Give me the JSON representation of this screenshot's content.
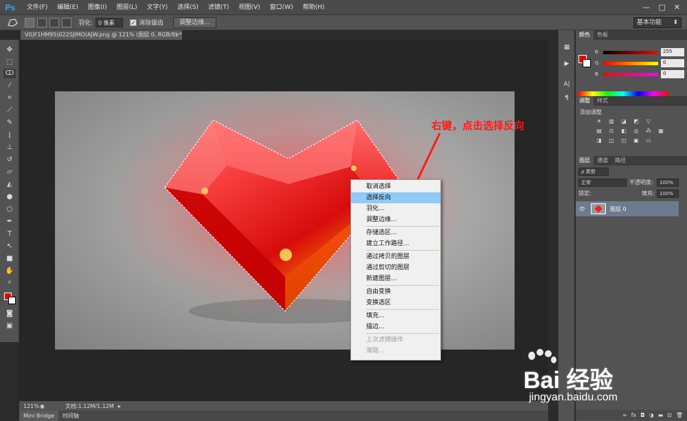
{
  "app": {
    "logo": "Ps",
    "menu": [
      "文件(F)",
      "编辑(E)",
      "图像(I)",
      "图层(L)",
      "文字(Y)",
      "选择(S)",
      "滤镜(T)",
      "视图(V)",
      "窗口(W)",
      "帮助(H)"
    ],
    "window_controls": [
      "—",
      "□",
      "✕"
    ]
  },
  "options": {
    "feather_label": "羽化:",
    "feather_value": "0 像素",
    "antialias_label": "消除锯齿",
    "refine_edge_button": "调整边缘...",
    "workspace": "基本功能"
  },
  "document": {
    "tab_title": "V0)F1HM95)022SJIMO(AJW.png @ 121% (图层 0, RGB/8) *",
    "tab_close": "×",
    "zoom": "121%",
    "doc_size": "文档:1.12M/1.12M"
  },
  "bottom_tabs": [
    "Mini Bridge",
    "时间轴"
  ],
  "color_panel": {
    "tabs": [
      "颜色",
      "色板"
    ],
    "sliders": [
      {
        "label": "R",
        "value": "255",
        "gradient": "linear-gradient(to right,#000,#f00)"
      },
      {
        "label": "G",
        "value": "0",
        "gradient": "linear-gradient(to right,#f00,#ff0)"
      },
      {
        "label": "B",
        "value": "0",
        "gradient": "linear-gradient(to right,#f00,#f0f)"
      }
    ],
    "foreground": "#e80000",
    "background": "#ffffff"
  },
  "adjustments": {
    "tabs": [
      "调整",
      "样式"
    ],
    "title": "添加调整"
  },
  "layers": {
    "tabs": [
      "图层",
      "通道",
      "路径"
    ],
    "filter": "ρ 类型",
    "blend_mode": "正常",
    "opacity_label": "不透明度:",
    "opacity": "100%",
    "lock_label": "锁定:",
    "fill_label": "填充:",
    "fill": "100%",
    "layer_name": "图层 0"
  },
  "context_menu": {
    "items": [
      {
        "label": "取消选择",
        "state": "normal"
      },
      {
        "label": "选择反向",
        "state": "highlighted"
      },
      {
        "label": "羽化...",
        "state": "normal"
      },
      {
        "label": "调整边缘...",
        "state": "normal"
      },
      {
        "sep": true
      },
      {
        "label": "存储选区...",
        "state": "normal"
      },
      {
        "label": "建立工作路径...",
        "state": "normal"
      },
      {
        "sep": true
      },
      {
        "label": "通过拷贝的图层",
        "state": "normal"
      },
      {
        "label": "通过剪切的图层",
        "state": "normal"
      },
      {
        "label": "新建图层...",
        "state": "normal"
      },
      {
        "sep": true
      },
      {
        "label": "自由变换",
        "state": "normal"
      },
      {
        "label": "变换选区",
        "state": "normal"
      },
      {
        "sep": true
      },
      {
        "label": "填充...",
        "state": "normal"
      },
      {
        "label": "描边...",
        "state": "normal"
      },
      {
        "sep": true
      },
      {
        "label": "上次滤镜操作",
        "state": "disabled"
      },
      {
        "label": "渐隐...",
        "state": "disabled"
      }
    ]
  },
  "annotation": "右键，点击选择反向",
  "watermark": {
    "brand": "Bai 经验",
    "url": "jingyan.baidu.com"
  }
}
